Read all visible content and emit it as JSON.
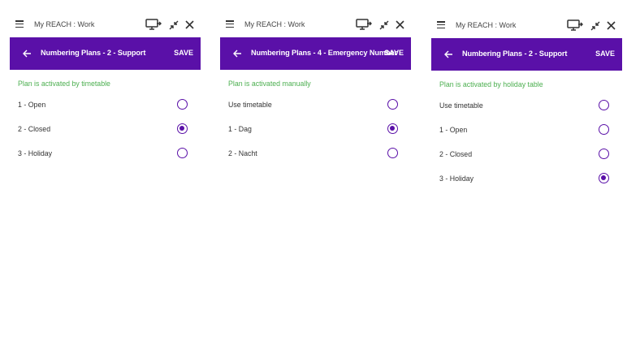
{
  "colors": {
    "accent": "#5a10a8",
    "status_green": "#4caf50"
  },
  "panels": [
    {
      "app_title": "My REACH : Work",
      "header_title": "Numbering Plans - 2 - Support",
      "save_label": "SAVE",
      "status": "Plan is activated by timetable",
      "options": [
        {
          "label": "1 - Open",
          "selected": false
        },
        {
          "label": "2 - Closed",
          "selected": true
        },
        {
          "label": "3 - Holiday",
          "selected": false
        }
      ]
    },
    {
      "app_title": "My REACH : Work",
      "header_title": "Numbering Plans - 4 - Emergency Number",
      "save_label": "SAVE",
      "status": "Plan is activated manually",
      "options": [
        {
          "label": "Use timetable",
          "selected": false
        },
        {
          "label": "1 - Dag",
          "selected": true
        },
        {
          "label": "2 - Nacht",
          "selected": false
        }
      ]
    },
    {
      "app_title": "My REACH : Work",
      "header_title": "Numbering Plans - 2 - Support",
      "save_label": "SAVE",
      "status": "Plan is activated by holiday table",
      "options": [
        {
          "label": "Use timetable",
          "selected": false
        },
        {
          "label": "1 - Open",
          "selected": false
        },
        {
          "label": "2 - Closed",
          "selected": false
        },
        {
          "label": "3 - Holiday",
          "selected": true
        }
      ]
    }
  ],
  "icons": {
    "menu": "hamburger-menu-icon",
    "monitor": "monitor-arrow-icon",
    "collapse": "collapse-arrows-icon",
    "close": "close-icon",
    "back": "arrow-left-icon"
  }
}
